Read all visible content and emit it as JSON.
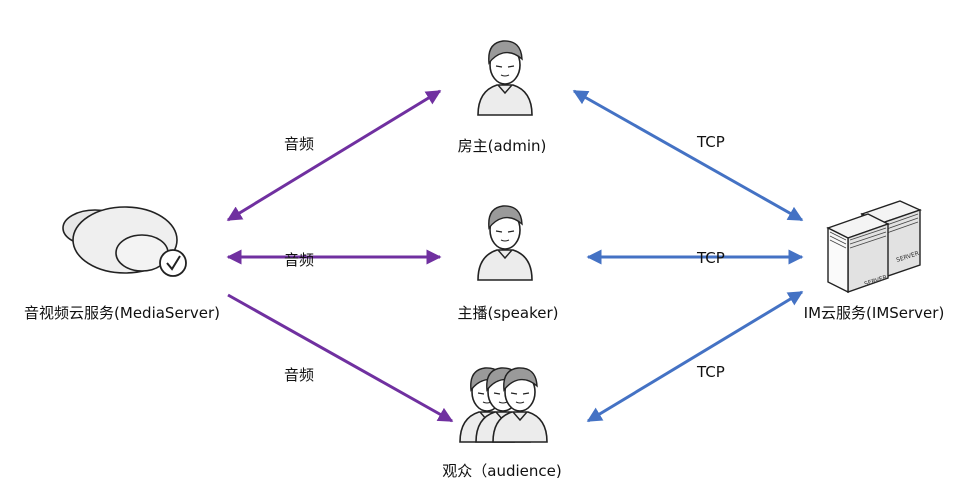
{
  "nodes": {
    "media_server": {
      "label": "音视频云服务(MediaServer)"
    },
    "admin": {
      "label": "房主(admin)"
    },
    "speaker": {
      "label": "主播(speaker)"
    },
    "audience": {
      "label": "观众（audience)"
    },
    "im_server": {
      "label": "IM云服务(IMServer)",
      "server_tag_1": "SERVER",
      "server_tag_2": "SERVER"
    }
  },
  "edges": {
    "audio_admin": {
      "label": "音频",
      "color": "#7030a0"
    },
    "audio_speaker": {
      "label": "音频",
      "color": "#7030a0"
    },
    "audio_audience": {
      "label": "音频",
      "color": "#7030a0"
    },
    "tcp_admin": {
      "label": "TCP",
      "color": "#4472c4"
    },
    "tcp_speaker": {
      "label": "TCP",
      "color": "#4472c4"
    },
    "tcp_audience": {
      "label": "TCP",
      "color": "#4472c4"
    }
  },
  "icons": {
    "media_server": "cloud-check-icon",
    "person": "person-icon",
    "group": "group-icon",
    "server": "server-icon"
  }
}
